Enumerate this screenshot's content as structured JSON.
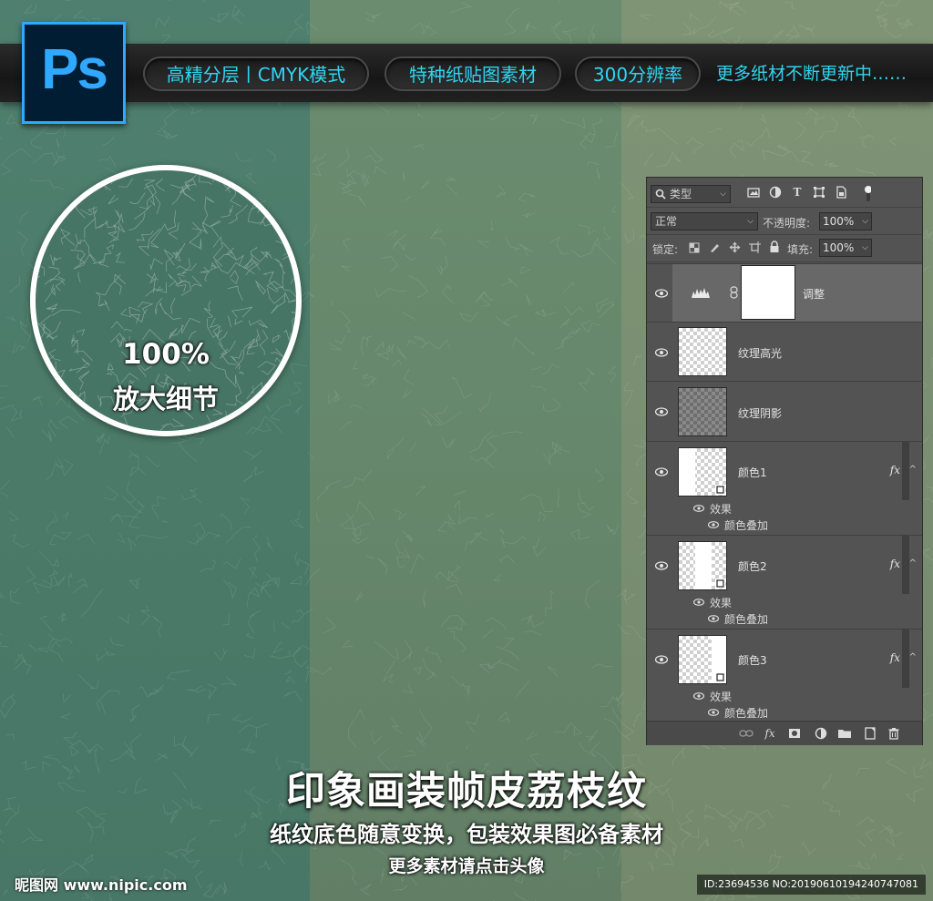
{
  "colors": {
    "accent_cyan": "#2fd5f0",
    "ps_blue": "#31a8ff",
    "ps_dark": "#001d34",
    "panel_bg": "#535353"
  },
  "logo": {
    "text": "Ps"
  },
  "banner": {
    "pills": [
      "高精分层丨CMYK模式",
      "特种纸贴图素材",
      "300分辨率"
    ],
    "more": "更多纸材不断更新中……"
  },
  "magnifier": {
    "percent": "100%",
    "label": "放大细节"
  },
  "layers_panel": {
    "filter_label": "类型",
    "blend_mode": "正常",
    "opacity_label": "不透明度:",
    "opacity_value": "100%",
    "lock_label": "锁定:",
    "fill_label": "填充:",
    "fill_value": "100%",
    "layers": [
      {
        "name": "调整",
        "type": "adjustment"
      },
      {
        "name": "纹理高光",
        "type": "pixel"
      },
      {
        "name": "纹理阴影",
        "type": "pixel"
      },
      {
        "name": "颜色1",
        "fx": "fx",
        "effects_label": "效果",
        "effect": "颜色叠加"
      },
      {
        "name": "颜色2",
        "fx": "fx",
        "effects_label": "效果",
        "effect": "颜色叠加"
      },
      {
        "name": "颜色3",
        "fx": "fx",
        "effects_label": "效果",
        "effect": "颜色叠加"
      }
    ]
  },
  "title": {
    "main": "印象画装帧皮荔枝纹",
    "sub": "纸纹底色随意变换，包装效果图必备素材",
    "small": "更多素材请点击头像"
  },
  "watermark": {
    "site": "昵图网 www.nipic.com",
    "id": "ID:23694536 NO:20190610194240747081"
  }
}
